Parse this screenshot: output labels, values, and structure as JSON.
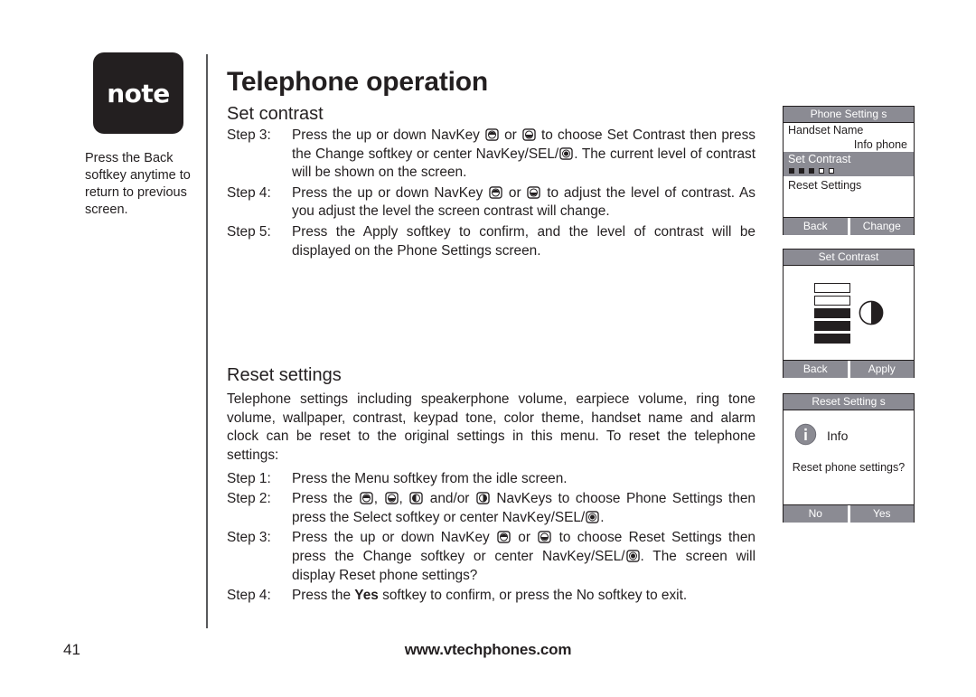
{
  "note": {
    "badge_label": "note",
    "text": "Press the Back softkey anytime to return to previous screen."
  },
  "page_title": "Telephone operation",
  "set_contrast_section": {
    "heading": "Set contrast",
    "steps": [
      {
        "label": "Step 3:",
        "text_part1": "Press the up or down NavKey ",
        "icon1": "navkey-up-icon",
        "text_part2": " or ",
        "icon2": "navkey-down-icon",
        "text_part3": " to choose Set Contrast  then press the Change  softkey or center NavKey/SEL/",
        "icon3": "navkey-select-icon",
        "text_part4": ". The current level of contrast will be shown on the screen."
      },
      {
        "label": "Step 4:",
        "text_part1": "Press the up or down NavKey ",
        "icon1": "navkey-up-icon",
        "text_part2": " or ",
        "icon2": "navkey-down-icon",
        "text_part3": " to adjust the level of contrast. As you adjust the level the screen contrast will change."
      },
      {
        "label": "Step 5:",
        "text_part1": "Press the Apply  softkey to confirm, and the level of contrast will be displayed on the Phone  Settings  screen."
      }
    ]
  },
  "reset_settings_section": {
    "heading": "Reset settings",
    "intro": "Telephone settings including speakerphone volume, earpiece volume, ring tone volume, wallpaper, contrast, keypad tone, color theme, handset name and alarm clock can be reset to the original settings in this menu. To reset the telephone settings:",
    "step1": {
      "label": "Step 1:",
      "text": "Press the Menu  softkey from the idle screen."
    },
    "step2": {
      "label": "Step 2:",
      "text_part1": "Press the ",
      "icon1": "navkey-up-icon",
      "text_part2": ", ",
      "icon2": "navkey-down-icon",
      "text_part3": ", ",
      "icon3": "navkey-left-icon",
      "text_part4": " and/or ",
      "icon4": "navkey-right-icon",
      "text_part5": " NavKeys to choose Phone Settings then press the Select  softkey or center NavKey/SEL/",
      "icon5": "navkey-select-icon",
      "text_part6": "."
    },
    "step3": {
      "label": "Step 3:",
      "text_part1": "Press the up or down NavKey ",
      "icon1": "navkey-up-icon",
      "text_part2": " or ",
      "icon2": "navkey-down-icon",
      "text_part3": " to choose Reset Settings then press the  Change  softkey or center NavKey/SEL/",
      "icon3": "navkey-select-icon",
      "text_part4": ". The screen will display Reset phone settings?"
    },
    "step4": {
      "label": "Step 4:",
      "text_part1": "Press the ",
      "bold": "Yes",
      "text_part2": " softkey to confirm, or press the No softkey to exit."
    }
  },
  "screens": {
    "phone_settings": {
      "title": "Phone Setting s",
      "row_handset_name": "Handset Name",
      "row_handset_value": "Info phone",
      "row_set_contrast": "Set Contrast",
      "contrast_dots": [
        "on",
        "on",
        "on",
        "off",
        "off"
      ],
      "row_reset_settings": "Reset Settings",
      "softkey_left": "Back",
      "softkey_right": "Change"
    },
    "set_contrast": {
      "title": "Set Contrast",
      "bars": [
        "empty",
        "empty",
        "filled",
        "filled",
        "filled"
      ],
      "contrast_circle_icon": "half-filled-circle-icon",
      "softkey_left": "Back",
      "softkey_right": "Apply"
    },
    "reset_settings": {
      "title": "Reset Setting s",
      "info_icon": "info-circle-icon",
      "info_label": "Info",
      "question": "Reset phone settings?",
      "softkey_left": "No",
      "softkey_right": "Yes"
    }
  },
  "footer": {
    "page_number": "41",
    "url": "www.vtechphones.com"
  },
  "colors": {
    "screen_gray": "#8b8b93",
    "ink": "#231f20"
  }
}
